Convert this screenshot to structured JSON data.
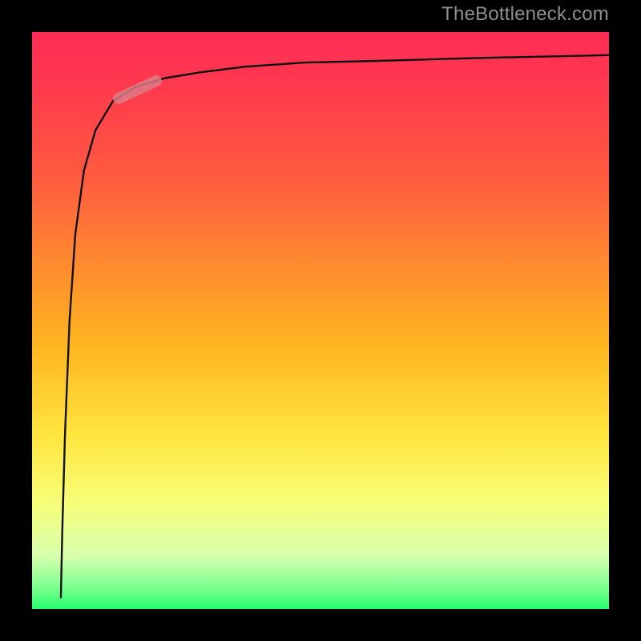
{
  "watermark": "TheBottleneck.com",
  "chart_data": {
    "type": "line",
    "title": "",
    "xlabel": "",
    "ylabel": "",
    "xlim": [
      0,
      1
    ],
    "ylim": [
      0,
      1
    ],
    "note": "Axes have no tick labels; values are normalized fractions of plot width/height. Curve starts low near x≈0.05, rises steeply, then asymptotically approaches y≈0.95 with a slight continued rise toward y≈0.96 at x=1. A small highlighted segment sits on the curve near x≈0.18.",
    "series": [
      {
        "name": "curve",
        "x": [
          0.05,
          0.052,
          0.057,
          0.065,
          0.075,
          0.09,
          0.11,
          0.14,
          0.18,
          0.23,
          0.29,
          0.37,
          0.47,
          0.6,
          0.77,
          1.0
        ],
        "y": [
          0.02,
          0.12,
          0.3,
          0.5,
          0.65,
          0.76,
          0.83,
          0.88,
          0.905,
          0.92,
          0.93,
          0.94,
          0.947,
          0.95,
          0.955,
          0.96
        ]
      }
    ],
    "highlight_segment": {
      "x_start": 0.15,
      "x_end": 0.215,
      "y_start": 0.885,
      "y_end": 0.915,
      "stroke_width": 14,
      "color": "#dd7e88"
    },
    "colors": {
      "curve": "#111111",
      "highlight": "#dd7e88",
      "gradient_top": "#ff2c56",
      "gradient_bottom": "#2aff6e",
      "frame": "#000000"
    }
  }
}
